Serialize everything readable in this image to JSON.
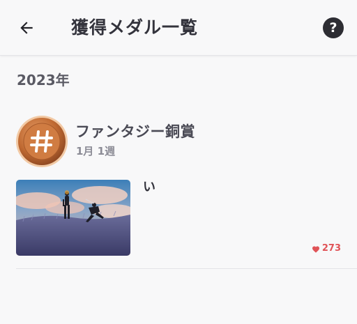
{
  "header": {
    "title": "獲得メダル一覧",
    "back_icon": "arrow-left-icon",
    "help_label": "?"
  },
  "section": {
    "year": "2023年"
  },
  "medal": {
    "name": "ファンタジー銅賞",
    "period": "1月 1週",
    "icon": "bronze-hash-medal-icon",
    "color": "#c8743a"
  },
  "post": {
    "title": "い",
    "likes": "273",
    "like_color": "#e05357"
  }
}
